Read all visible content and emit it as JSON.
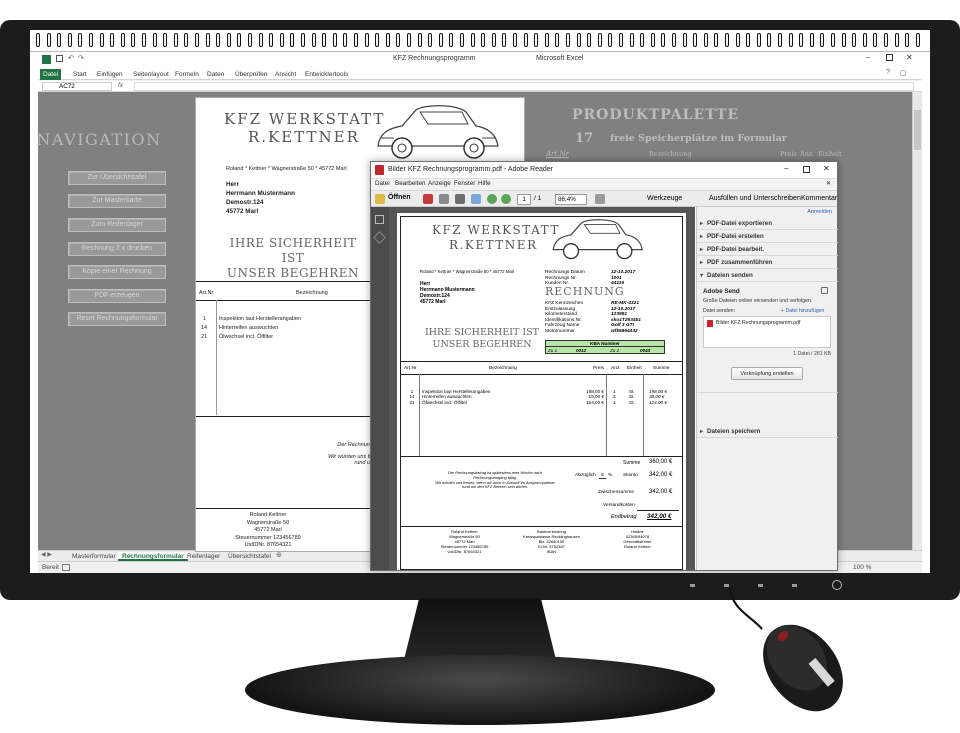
{
  "excel": {
    "window_title": "KFZ Rechnungsprogramm",
    "app_name": "Microsoft Excel",
    "ribbon_tabs": [
      "Datei",
      "Start",
      "Einfügen",
      "Seitenlayout",
      "Formeln",
      "Daten",
      "Überprüfen",
      "Ansicht",
      "Entwicklertools"
    ],
    "name_box": "AC72",
    "fx": "fx",
    "sheet_tabs": [
      "Masterformular",
      "Rechnungsformular",
      "Reifenlager",
      "Übersichtstafel"
    ],
    "active_sheet": 1,
    "status_text": "Bereit",
    "zoom": "100 %",
    "navigation": {
      "title": "NAVIGATION",
      "buttons": [
        "Zur Übersichtstafel",
        "Zur Masterkarte",
        "Zum Reifenlager",
        "Rechnung 2 x drucken",
        "Kopie einer Rechnung",
        "PDF erzeugen",
        "Reset Rechnungsformular"
      ]
    },
    "produktpalette": {
      "title": "PRODUKTPALETTE",
      "count": "17",
      "subtitle": "freie Speicherplätze im Formular",
      "col_artnr": "Art.Nr",
      "col_bezeichnung": "Bezeichnung",
      "col_preis": "Preis",
      "col_anz": "Anz.",
      "col_einheit": "Einheit"
    }
  },
  "invoice": {
    "company_line1": "KFZ WERKSTATT",
    "company_line2": "R.KETTNER",
    "sender_line": "Roland  *  Kettner  *  Wagnerstraße 50  *  45772 Marl",
    "recipient": {
      "salutation": "Herr",
      "name": "Herrmann Mustermann",
      "street": "Demostr.124",
      "city": "45772 Marl"
    },
    "slogan_line1": "IHRE SICHERHEIT IST",
    "slogan_line2": "UNSER BEGEHREN",
    "doc_title": "RECHNUNG",
    "meta": [
      {
        "label": "Rechnungs Datum",
        "value": "12-10.2017"
      },
      {
        "label": "Rechnungs Nr.",
        "value": "1001"
      },
      {
        "label": "Kunden Nr.",
        "value": "44116"
      }
    ],
    "vehicle": [
      {
        "label": "KFZ Kennzeichen",
        "value": "RE-MK-4321"
      },
      {
        "label": "Erstzulassung",
        "value": "12-10.2017"
      },
      {
        "label": "Kilometerstand",
        "value": "123991"
      },
      {
        "label": "Identifikations.Nr.",
        "value": "sko1T263451"
      },
      {
        "label": "Fahrzeug Name",
        "value": "Golf 3 GTI"
      },
      {
        "label": "Motornummer",
        "value": "wf55864432"
      }
    ],
    "kba": {
      "title": "KBA Nummer",
      "zu1_label": "Zu 1",
      "zu1_value": "0012",
      "zu2_label": "Zu 2",
      "zu2_value": "0043"
    },
    "columns": {
      "artnr": "Art.Nr",
      "bezeichnung": "Bezeichnung",
      "preis": "Preis",
      "anz": "Anz.",
      "einheit": "Einheit",
      "summe": "Summe"
    },
    "items": [
      {
        "artnr": "1",
        "bez": "Inspektion laut Herstellerangaben",
        "preis": "198,00 €",
        "anz": "1",
        "einheit": "St.",
        "summe": "198,00 €"
      },
      {
        "artnr": "14",
        "bez": "Hinterreifen auswuchten",
        "preis": "19,00 €",
        "anz": "2",
        "einheit": "St.",
        "summe": "38,00 €"
      },
      {
        "artnr": "21",
        "bez": "Ölwechsel incl. Ölfilter",
        "preis": "124,00 €",
        "anz": "1",
        "einheit": "St.",
        "summe": "124,00 €"
      }
    ],
    "totals": {
      "summe_label": "Summe",
      "summe": "360,00 €",
      "abzug_label": "Abzüglich",
      "abzug_pct": "5",
      "abzug_unit": "%",
      "skonto_label": "Skonto",
      "skonto": "342,00 €",
      "zwischen_label": "Zwischensumme",
      "zwischen": "342,00 €",
      "versand_label": "Versandkosten",
      "end_label": "Endbetrag",
      "end": "342,00 €"
    },
    "note_line1": "Der Rechnungsbetrag ist spätestens eine Woche nach",
    "note_line2": "Rechnungseingang fällig.",
    "note_line3": "Wir würden uns freuen, wenn wir auch in Zukunft Ihr Ansprechpartner",
    "note_line4": "rund um den KFZ Bereich sein dürfen.",
    "footer": {
      "col1": [
        "Roland Kettner",
        "Wagnerstraße 50",
        "45772 Marl",
        "Steuernummer 123456789",
        "UstIDNr. 87654321"
      ],
      "col2": [
        "Bankverbindung",
        "Kreissparkasse Recklinghausen",
        "Blz. 42650150",
        "Kt.Nr. 5752387",
        "IBAN"
      ],
      "col3": [
        "Hotline",
        "02365/94078",
        "",
        "Geschäftsführer",
        "Roland Kettner"
      ]
    }
  },
  "excel_sheet_partial": {
    "note_line1": "Der Rechnungsbetrag ist spätestens eine Woche na",
    "note_line2": "Rechnungseingang fällig.",
    "note_line3": "Wir würden uns freuen, wenn wir auch in Zukunft Ihr Anspre",
    "note_line4": "rund um den KFZ Bereich sein dürfen.",
    "footer_col1": [
      "Roland Kettner",
      "Wagnerstraße 50",
      "45772 Marl",
      "Steuernummer 123456789",
      "UstIDNr. 87654321"
    ],
    "footer_col2": [
      "Bankverbin",
      "Kreissparkasse Re",
      "Blz. 4265",
      "Kt.Nr. 5752",
      "IBA"
    ]
  },
  "acrobat": {
    "title": "Bilder KFZ Rechnungsprogramm.pdf - Adobe Reader",
    "menu": [
      "Datei",
      "Bearbeiten",
      "Anzeige",
      "Fenster",
      "Hilfe"
    ],
    "open_label": "Öffnen",
    "page_current": "1",
    "page_total": "/ 1",
    "zoom": "86,4%",
    "tools_label": "Werkzeuge",
    "fill_sign_label": "Ausfüllen und Unterschreiben",
    "comment_label": "Kommentar",
    "signin_label": "Anmelden",
    "panels": [
      "PDF-Datei exportieren",
      "PDF-Datei erstellen",
      "PDF-Datei bearbeit.",
      "PDF zusammenführen",
      "Dateien senden"
    ],
    "send": {
      "heading": "Adobe Send",
      "desc": "Große Dateien online versenden und verfolgen.",
      "files_label": "Datei senden:",
      "add_label": "+ Datei hinzufügen",
      "file_name": "Bilder KFZ Rechnungsprogramm.pdf",
      "file_info": "1 Datei / 281 KB",
      "create_link": "Verknüpfung erstellen"
    },
    "save_panel": "Dateien speichern"
  },
  "colors": {
    "excel_green": "#217346",
    "kba_green": "#b7e4a8",
    "bezel": "#1c1c1c"
  }
}
